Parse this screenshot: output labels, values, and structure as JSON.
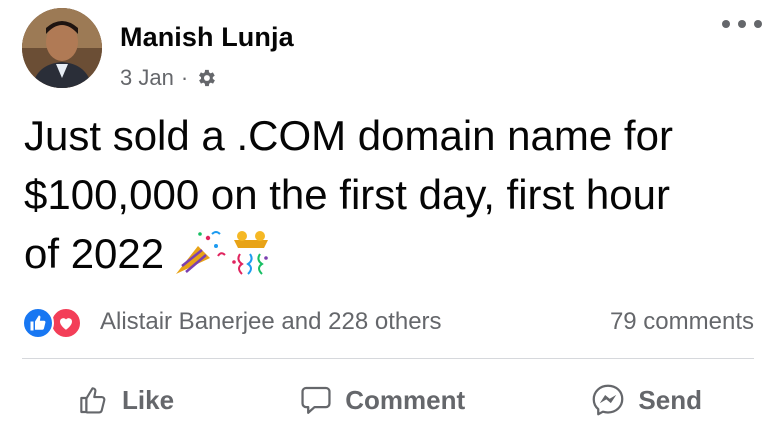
{
  "post": {
    "author": {
      "name": "Manish Lunja"
    },
    "meta": {
      "date": "3 Jan",
      "separator": "·",
      "audience_icon": "gear-icon"
    },
    "text": {
      "line1": "Just sold a .COM domain name for",
      "line2": "$100,000 on the first day, first hour",
      "line3": "of 2022",
      "emoji": "party-popper-icon"
    },
    "stats": {
      "reaction_icons": [
        "like-icon",
        "love-icon"
      ],
      "reactions_text": "Alistair Banerjee and 228 others",
      "comments_text": "79 comments"
    },
    "actions": [
      {
        "label": "Like",
        "icon": "thumbs-up-icon"
      },
      {
        "label": "Comment",
        "icon": "comment-bubble-icon"
      },
      {
        "label": "Send",
        "icon": "messenger-icon"
      }
    ],
    "colors": {
      "like_blue": "#1877f2",
      "love_red": "#f33e58",
      "muted": "#65676b",
      "text": "#050505"
    }
  }
}
